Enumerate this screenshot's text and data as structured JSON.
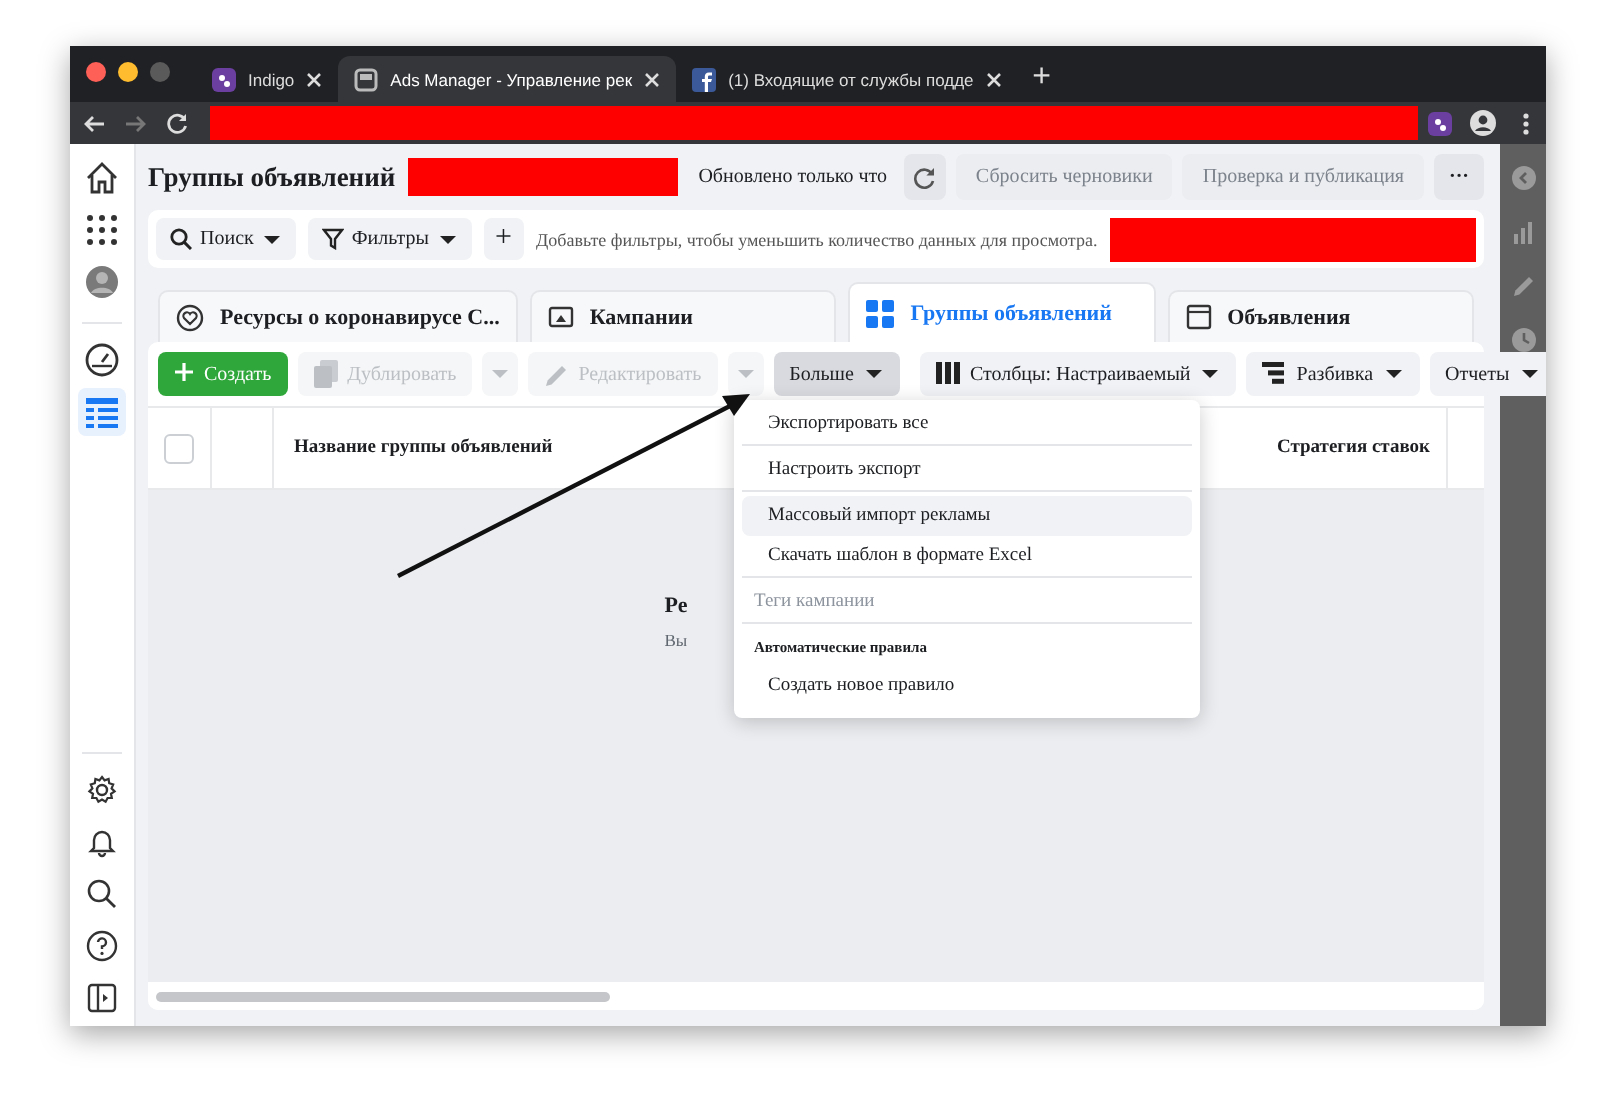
{
  "browser": {
    "tabs": [
      {
        "title": "Indigo",
        "selected": false
      },
      {
        "title": "Ads Manager - Управление рек",
        "selected": true
      },
      {
        "title": "(1) Входящие от службы подде",
        "selected": false
      }
    ],
    "new_tab": "+"
  },
  "header": {
    "title": "Группы объявлений",
    "updated": "Обновлено только что",
    "actions": [
      {
        "label": "Сбросить черновики",
        "disabled": true
      },
      {
        "label": "Проверка и публикация",
        "disabled": true
      }
    ],
    "more": "···"
  },
  "sidebar": {
    "items": [
      {
        "selected": false
      },
      {
        "selected": false
      },
      {
        "selected": false
      },
      {
        "selected": false
      },
      {
        "selected": true
      }
    ]
  },
  "filter_bar": {
    "search": "Поиск",
    "filters": "Фильтры",
    "add": "+",
    "hint": "Добавьте фильтры, чтобы уменьшить количество данных для просмотра."
  },
  "object_tabs": [
    {
      "label": "Ресурсы о коронавирусе C...",
      "selected": false
    },
    {
      "label": "Кампании",
      "selected": false
    },
    {
      "label": "Группы объявлений",
      "selected": true
    },
    {
      "label": "Объявления",
      "selected": false
    }
  ],
  "toolbar": {
    "left": [
      {
        "kind": "create",
        "label": "Создать",
        "disabled": false,
        "pressed": false
      },
      {
        "kind": "duplicate",
        "label": "Дублировать",
        "disabled": true,
        "pressed": false
      },
      {
        "kind": "edit",
        "label": "Редактировать",
        "disabled": true,
        "pressed": false
      },
      {
        "kind": "more",
        "label": "Больше",
        "disabled": false,
        "pressed": true
      }
    ],
    "right": [
      {
        "kind": "columns",
        "label": "Столбцы: Настраиваемый"
      },
      {
        "kind": "breakdown",
        "label": "Разбивка"
      },
      {
        "kind": "reports",
        "label": "Отчеты"
      }
    ]
  },
  "table": {
    "select_all": {
      "checked": false
    },
    "columns": [
      "Название группы объявлений",
      "Стратегия ставок"
    ],
    "empty_title": "Ре",
    "empty_text": "Вы"
  },
  "menu": {
    "items": [
      {
        "kind": "item",
        "label": "Экспортировать все",
        "highlighted": false,
        "disabled": false,
        "divider_after": true
      },
      {
        "kind": "item",
        "label": "Настроить экспорт",
        "highlighted": false,
        "disabled": false,
        "divider_after": true
      },
      {
        "kind": "item",
        "label": "Массовый импорт рекламы",
        "highlighted": true,
        "disabled": false,
        "divider_after": false
      },
      {
        "kind": "item",
        "label": "Скачать шаблон в формате Excel",
        "highlighted": false,
        "disabled": false,
        "divider_after": true
      },
      {
        "kind": "section",
        "label": "Теги кампании",
        "highlighted": false,
        "disabled": true,
        "divider_after": true
      },
      {
        "kind": "heading",
        "label": "Автоматические правила",
        "highlighted": false,
        "disabled": false,
        "divider_after": false
      },
      {
        "kind": "item",
        "label": "Создать новое правило",
        "highlighted": false,
        "disabled": false,
        "divider_after": false
      }
    ]
  }
}
